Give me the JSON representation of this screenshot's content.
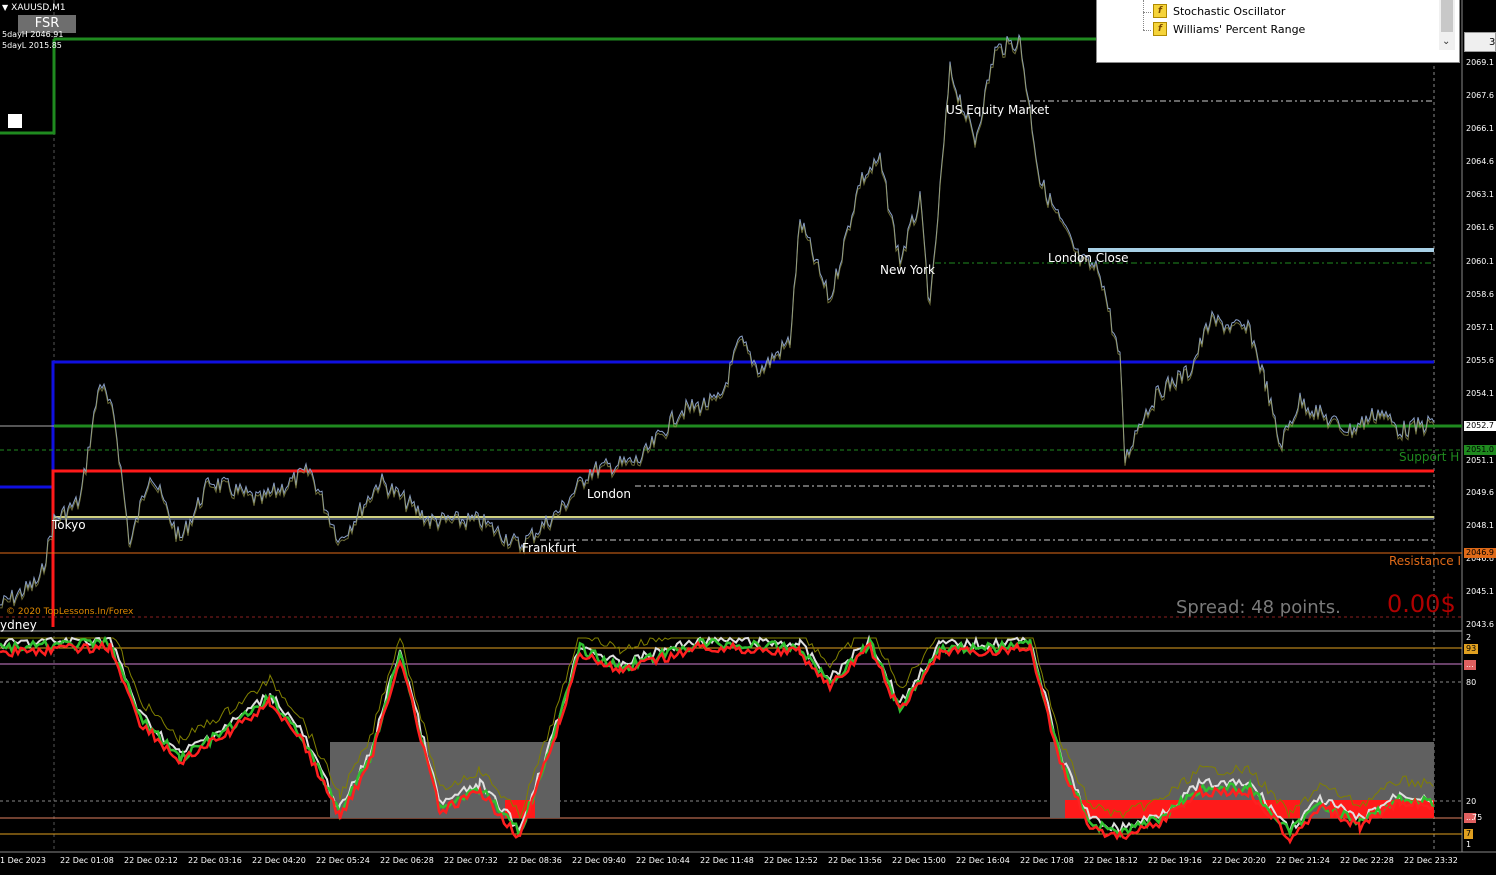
{
  "header": {
    "symbol": "XAUUSD,M1",
    "fsr_button": "FSR",
    "five_day_high": "5dayH 2046.91",
    "five_day_low": "5dayL 2015.85"
  },
  "sessions": {
    "tokyo": "Tokyo",
    "frankfurt": "Frankfurt",
    "london": "London",
    "new_york": "New York",
    "us_equity": "US Equity Market",
    "london_close": "London Close",
    "sydney": "ydney"
  },
  "labels": {
    "spread": "Spread: 48 points.",
    "profit": "0.00$",
    "support": "Support H",
    "resistance": "Resistance I",
    "copyright": "© 2020 TopLessons.In/Forex"
  },
  "price_axis": [
    "2069.1",
    "2067.6",
    "2066.1",
    "2064.6",
    "2063.1",
    "2061.6",
    "2060.1",
    "2058.6",
    "2057.1",
    "2055.6",
    "2054.1",
    "2052.7",
    "2051.1",
    "2049.6",
    "2048.1",
    "2046.6",
    "2045.1",
    "2043.6"
  ],
  "price_tags": {
    "current": "2052.7",
    "support": "2051.0",
    "resistance": "2046.9"
  },
  "time_axis": [
    "1 Dec 2023",
    "22 Dec 01:08",
    "22 Dec 02:12",
    "22 Dec 03:16",
    "22 Dec 04:20",
    "22 Dec 05:24",
    "22 Dec 06:28",
    "22 Dec 07:32",
    "22 Dec 08:36",
    "22 Dec 09:40",
    "22 Dec 10:44",
    "22 Dec 11:48",
    "22 Dec 12:52",
    "22 Dec 13:56",
    "22 Dec 15:00",
    "22 Dec 16:04",
    "22 Dec 17:08",
    "22 Dec 18:12",
    "22 Dec 19:16",
    "22 Dec 20:20",
    "22 Dec 21:24",
    "22 Dec 22:28",
    "22 Dec 23:32"
  ],
  "oscillator_axis": {
    "top": "2",
    "level_93": "93",
    "level_mid": "...",
    "level_80": "80",
    "level_20": "20",
    "level_low": "...",
    "level_7": "7",
    "bottom": "1",
    "tag_75": "75"
  },
  "navigator": {
    "items": [
      "Stochastic Oscillator",
      "Williams' Percent Range"
    ],
    "icon_glyph": "f"
  },
  "small_box": "3",
  "colors": {
    "blue_level": "#1010e0",
    "red_level": "#ff1a1a",
    "green_level": "#1f8a1f",
    "price_line": "#8aa0c8",
    "osc_red": "#ff2020",
    "osc_green": "#30c030",
    "osc_white": "#e0e0e0",
    "osc_olive": "#808000",
    "light_blue": "#a8d0e6"
  }
}
